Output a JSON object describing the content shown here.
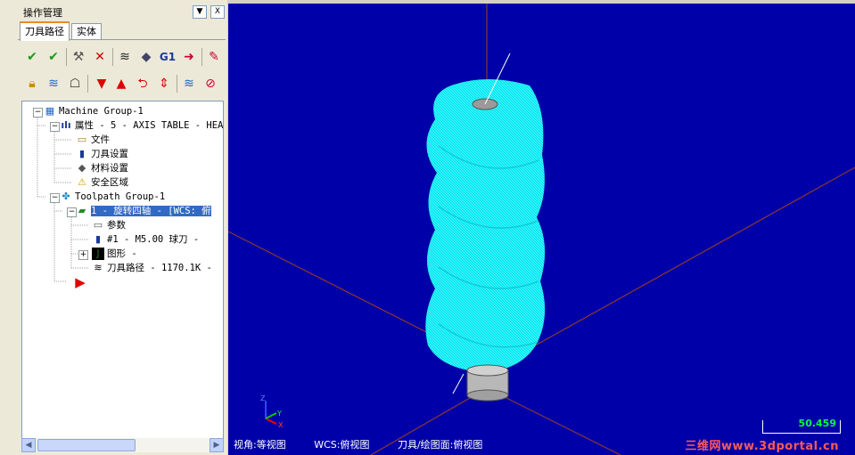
{
  "panel": {
    "title": "操作管理",
    "pin_icon": "pin-icon",
    "close_glyph": "X",
    "tabs": [
      {
        "label": "刀具路径",
        "active": true
      },
      {
        "label": "实体",
        "active": false
      }
    ]
  },
  "toolbar_rows": [
    [
      "select-all-ops-icon",
      "select-dirty-ops-icon",
      "regenerate-icon",
      "regenerate-dirty-icon",
      "backplot-icon",
      "verify-icon",
      "g1-post-icon",
      "post-selected-icon",
      "highfeed-icon"
    ],
    [
      "lock-icon",
      "toggle-display-icon",
      "ghost-icon",
      "move-down-icon",
      "move-up-icon",
      "insert-arrow-icon",
      "scroll-icon",
      "help-icon",
      "clear-icon"
    ]
  ],
  "tree": {
    "machine_group": "Machine Group-1",
    "properties": "属性 - 5 - AXIS TABLE - HEA",
    "files": "文件",
    "tool_settings": "刀具设置",
    "stock_setup": "材料设置",
    "safety_zone": "安全区域",
    "toolpath_group": "Toolpath Group-1",
    "operation": "1 - 旋转四轴 - [WCS: 俯",
    "parameters": "参数",
    "tool": "#1 - M5.00 球刀 -",
    "geometry": "图形 -",
    "toolpath": "刀具路径 - 1170.1K -"
  },
  "viewport": {
    "gview": "视角:等视图",
    "wcs": "WCS:俯视图",
    "tplane": "刀具/绘图面:俯视图",
    "scale_value": "50.459",
    "watermark": "三维网www.3dportal.cn",
    "axis_x": "X",
    "axis_y": "Y",
    "axis_z": "Z"
  },
  "colors": {
    "viewport_bg": "#0000a8",
    "toolpath": "#00e8f0",
    "axis_lines": "#8b3a2a",
    "scale_text": "#00ff40"
  }
}
